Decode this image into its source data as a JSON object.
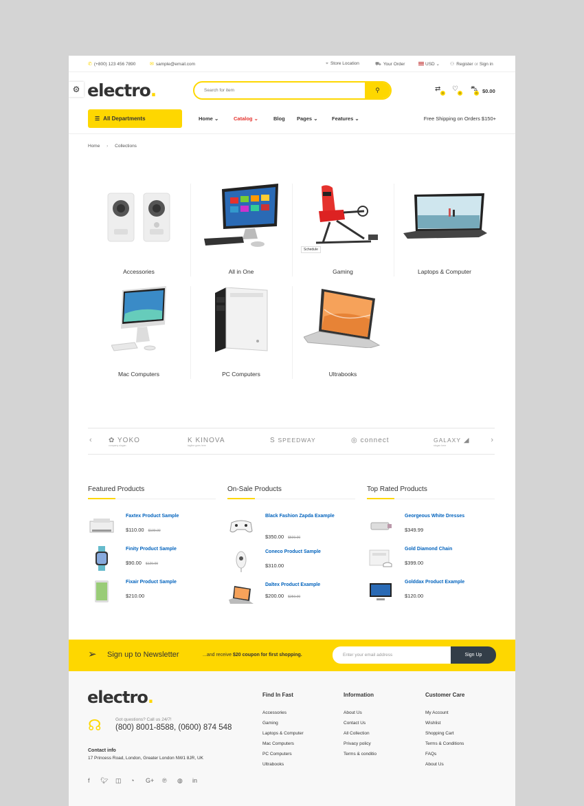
{
  "topbar": {
    "phone": "(+800) 123 456 7890",
    "email": "sample@email.com",
    "store_location": "Store Location",
    "your_order": "Your Order",
    "currency": "USD",
    "register": "Register",
    "or": "or",
    "sign_in": "Sign in"
  },
  "header": {
    "logo": "electro",
    "logo_dot": ".",
    "search_placeholder": "Search for item",
    "compare_count": "0",
    "wishlist_count": "0",
    "cart_count": "0",
    "cart_total": "$0.00"
  },
  "nav": {
    "all_departments": "All Departments",
    "items": [
      "Home",
      "Catalog",
      "Blog",
      "Pages",
      "Features"
    ],
    "free_shipping": "Free Shipping on Orders $150+"
  },
  "breadcrumb": [
    "Home",
    "Collections"
  ],
  "categories": [
    {
      "label": "Accessories"
    },
    {
      "label": "All in One"
    },
    {
      "label": "Gaming",
      "badge": "Schedule"
    },
    {
      "label": "Laptops & Computer"
    },
    {
      "label": "Mac Computers"
    },
    {
      "label": "PC Computers"
    },
    {
      "label": "Ultrabooks"
    }
  ],
  "brands": [
    {
      "name": "YOKO",
      "tagline": "company slogan"
    },
    {
      "name": "KINOVA",
      "tagline": "tagline goes here"
    },
    {
      "name": "SPEEDWAY",
      "tagline": ""
    },
    {
      "name": "connect",
      "tagline": ""
    },
    {
      "name": "GALAXY",
      "tagline": "slogan here"
    }
  ],
  "product_columns": [
    {
      "title": "Featured Products",
      "items": [
        {
          "name": "Faxtex Product Sample",
          "price": "$110.00",
          "old_price": "$199.00"
        },
        {
          "name": "Finity Product Sample",
          "price": "$90.00",
          "old_price": "$120.00"
        },
        {
          "name": "Fixair Product Sample",
          "price": "$210.00",
          "old_price": ""
        }
      ]
    },
    {
      "title": "On-Sale Products",
      "items": [
        {
          "name": "Black Fashion Zapda Example",
          "price": "$350.00",
          "old_price": "$500.00"
        },
        {
          "name": "Coneco Product Sample",
          "price": "$310.00",
          "old_price": ""
        },
        {
          "name": "Daltex Product Example",
          "price": "$200.00",
          "old_price": "$250.00"
        }
      ]
    },
    {
      "title": "Top Rated Products",
      "items": [
        {
          "name": "Georgeous White Dresses",
          "price": "$349.99",
          "old_price": ""
        },
        {
          "name": "Gold Diamond Chain",
          "price": "$399.00",
          "old_price": ""
        },
        {
          "name": "Golddax Product Example",
          "price": "$120.00",
          "old_price": ""
        }
      ]
    }
  ],
  "newsletter": {
    "title": "Sign up to Newsletter",
    "sub_prefix": "...and receive ",
    "sub_bold": "$20 coupon for first shopping.",
    "placeholder": "Enter your email address",
    "button": "Sign Up"
  },
  "footer": {
    "logo": "electro",
    "got_questions": "Got questions? Call us 24/7!",
    "phones": "(800) 8001-8588, (0600) 874 548",
    "contact_title": "Contact info",
    "address": "17 Princess Road, London, Greater London NW1 8JR, UK",
    "columns": [
      {
        "title": "Find In Fast",
        "links": [
          "Accessories",
          "Gaming",
          "Laptops & Computer",
          "Mac Computers",
          "PC Computers",
          "Ultrabooks"
        ]
      },
      {
        "title": "Information",
        "links": [
          "About Us",
          "Contact Us",
          "All Collection",
          "Privacy policy",
          "Terms & conditio"
        ]
      },
      {
        "title": "Customer Care",
        "links": [
          "My Account",
          "Wishlist",
          "Shopping Cart",
          "Terms & Conditions",
          "FAQs",
          "About Us"
        ]
      }
    ],
    "social": [
      "facebook-icon",
      "twitter-icon",
      "instagram-icon",
      "rss-icon",
      "google-plus-icon",
      "pinterest-icon",
      "dribbble-icon",
      "linkedin-icon"
    ]
  },
  "colors": {
    "accent": "#fed700",
    "link": "#0062bd",
    "active_nav": "#e5322d",
    "dark": "#333e48"
  }
}
